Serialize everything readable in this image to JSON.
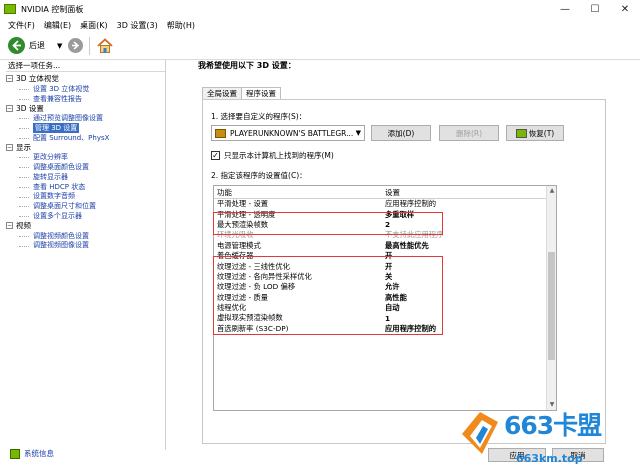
{
  "window": {
    "title": "NVIDIA 控制面板",
    "controls": [
      "—",
      "☐",
      "✕"
    ]
  },
  "menu": [
    "文件(F)",
    "编辑(E)",
    "桌面(K)",
    "3D 设置(3)",
    "帮助(H)"
  ],
  "toolbar": {
    "back_label": "后退"
  },
  "sidebar": {
    "header": "选择一项任务...",
    "tree": [
      {
        "label": "3D 立体视觉",
        "items": [
          "设置 3D 立体视觉",
          "查看兼容性报告"
        ]
      },
      {
        "label": "3D 设置",
        "items": [
          "通过预览调整图像设置",
          "管理 3D 设置",
          "配置 Surround、PhysX"
        ],
        "selected_index": 1
      },
      {
        "label": "显示",
        "items": [
          "更改分辨率",
          "调整桌面颜色设置",
          "旋转显示器",
          "查看 HDCP 状态",
          "设置数字音频",
          "调整桌面尺寸和位置",
          "设置多个显示器"
        ]
      },
      {
        "label": "视频",
        "items": [
          "调整视频颜色设置",
          "调整视频图像设置"
        ]
      }
    ],
    "system_info": "系统信息"
  },
  "main": {
    "heading": "我希望使用以下 3D 设置：",
    "tabs": [
      "全局设置",
      "程序设置"
    ],
    "step1": "1. 选择要自定义的程序(S)：",
    "program": "PLAYERUNKNOWN'S BATTLEGR...",
    "add_button": "添加(D)",
    "remove_button": "删除(R)",
    "restore_button": "恢复(T)",
    "show_only_checkbox": "只显示本计算机上找到的程序(M)",
    "step2": "2. 指定该程序的设置值(C)：",
    "columns": [
      "功能",
      "设置"
    ],
    "rows": [
      {
        "feature": "平滑处理 - 设置",
        "setting": "应用程序控制的",
        "style": "normal"
      },
      {
        "feature": "平滑处理 - 透明度",
        "setting": "多重取样",
        "style": "bold"
      },
      {
        "feature": "最大预渲染帧数",
        "setting": "2",
        "style": "bold"
      },
      {
        "feature": "环境光吸收",
        "setting": "不支持此应用程序",
        "style": "dim"
      },
      {
        "feature": "电源管理模式",
        "setting": "最高性能优先",
        "style": "bold"
      },
      {
        "feature": "着色缓存器",
        "setting": "开",
        "style": "bold"
      },
      {
        "feature": "纹理过滤 - 三线性优化",
        "setting": "开",
        "style": "bold"
      },
      {
        "feature": "纹理过滤 - 各向异性采样优化",
        "setting": "关",
        "style": "bold"
      },
      {
        "feature": "纹理过滤 - 负 LOD 偏移",
        "setting": "允许",
        "style": "bold"
      },
      {
        "feature": "纹理过滤 - 质量",
        "setting": "高性能",
        "style": "bold"
      },
      {
        "feature": "线程优化",
        "setting": "自动",
        "style": "bold"
      },
      {
        "feature": "虚拟现实预渲染帧数",
        "setting": "1",
        "style": "bold"
      },
      {
        "feature": "首选刷新率 (S3C-DP)",
        "setting": "应用程序控制的",
        "style": "bold"
      }
    ]
  },
  "footer": {
    "apply": "应用",
    "cancel": "取消"
  },
  "watermark": {
    "text": "663卡盟",
    "url": "663km.top"
  },
  "colors": {
    "nvidia_green": "#76b900",
    "highlight_red": "#e0383b",
    "link_blue": "#1a3fa8",
    "watermark_blue": "#1f86d8",
    "watermark_orange": "#f08a1c"
  }
}
